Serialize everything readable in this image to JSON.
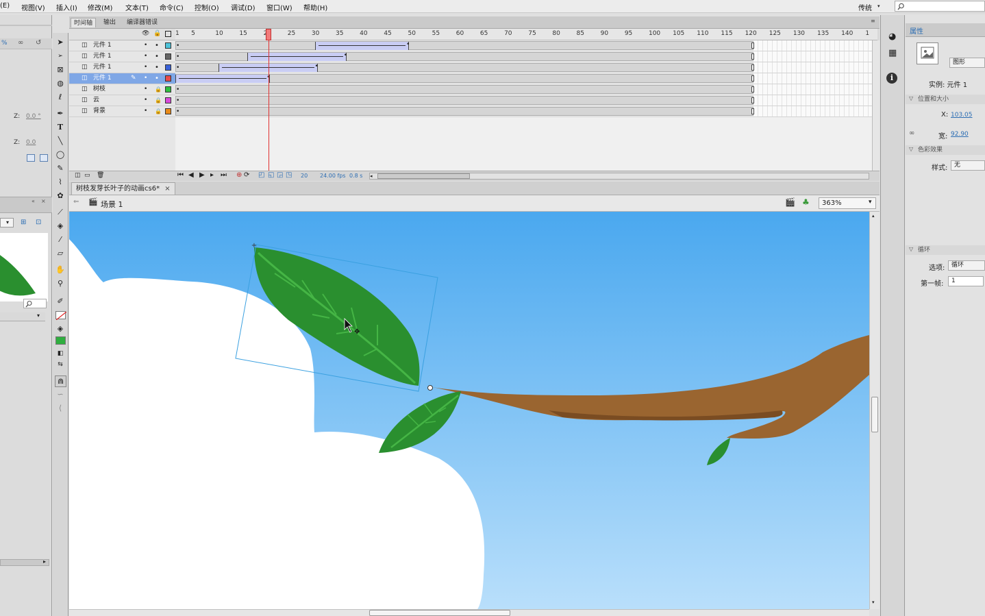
{
  "menubar": {
    "items": [
      "(E)",
      "视图(V)",
      "插入(I)",
      "修改(M)",
      "文本(T)",
      "命令(C)",
      "控制(O)",
      "调试(D)",
      "窗口(W)",
      "帮助(H)"
    ],
    "workspace": "传统"
  },
  "timeline": {
    "tabs": [
      "时间轴",
      "输出",
      "编译器错误"
    ],
    "ruler": [
      "1",
      "5",
      "10",
      "15",
      "20",
      "25",
      "30",
      "35",
      "40",
      "45",
      "50",
      "55",
      "60",
      "65",
      "70",
      "75",
      "80",
      "85",
      "90",
      "95",
      "100",
      "105",
      "110",
      "115",
      "120",
      "125",
      "130",
      "135",
      "140",
      "1"
    ],
    "layers": [
      {
        "name": "元件 1",
        "color": "#4fc3d9",
        "tween_start": 30,
        "tween_end": 49,
        "selected": false,
        "locked": false
      },
      {
        "name": "元件 1",
        "color": "#666666",
        "tween_start": 16,
        "tween_end": 36,
        "selected": false,
        "locked": false
      },
      {
        "name": "元件 1",
        "color": "#3a62d8",
        "tween_start": 10,
        "tween_end": 30,
        "selected": false,
        "locked": false
      },
      {
        "name": "元件 1",
        "color": "#e84a4a",
        "tween_start": 1,
        "tween_end": 20,
        "selected": true,
        "locked": false
      },
      {
        "name": "树枝",
        "color": "#2fbf3f",
        "tween_start": null,
        "tween_end": null,
        "selected": false,
        "locked": true
      },
      {
        "name": "云",
        "color": "#d94ad9",
        "tween_start": null,
        "tween_end": null,
        "selected": false,
        "locked": true
      },
      {
        "name": "背景",
        "color": "#e88a1a",
        "tween_start": null,
        "tween_end": null,
        "selected": false,
        "locked": true
      }
    ],
    "total_frames": 120,
    "playhead_frame": 20,
    "status": {
      "frame": "20",
      "fps": "24.00 fps",
      "time": "0.8 s"
    }
  },
  "document": {
    "tab_title": "树枝发芽长叶子的动画cs6*",
    "close_glyph": "×",
    "scene": "场景 1",
    "zoom": "363%"
  },
  "left_panel": {
    "pct": "%",
    "z1_label": "Z:",
    "z1_value": "0.0 °",
    "z2_label": "Z:",
    "z2_value": "0.0"
  },
  "properties": {
    "tab": "属性",
    "type": "图形",
    "instance_label": "实例: 元件 1",
    "sections": [
      "位置和大小",
      "色彩效果",
      "循环"
    ],
    "x_label": "X:",
    "x_value": "103.05",
    "w_label": "宽:",
    "w_value": "92.90",
    "style_label": "样式:",
    "style_value": "无",
    "option_label": "选项:",
    "option_value": "循环",
    "first_frame_label": "第一帧:",
    "first_frame_value": "1"
  },
  "colors": {
    "sky_top": "#4aa8ef",
    "sky_bottom": "#b9dffb",
    "cloud": "#ffffff",
    "leaf": "#2a8f2f",
    "leaf_vein": "#45b545",
    "branch": "#9a6530",
    "branch_shadow": "#7a4c22",
    "selection": "#3aa0e0",
    "playhead": "#e03030",
    "tween_fill": "#c9cdf4"
  }
}
